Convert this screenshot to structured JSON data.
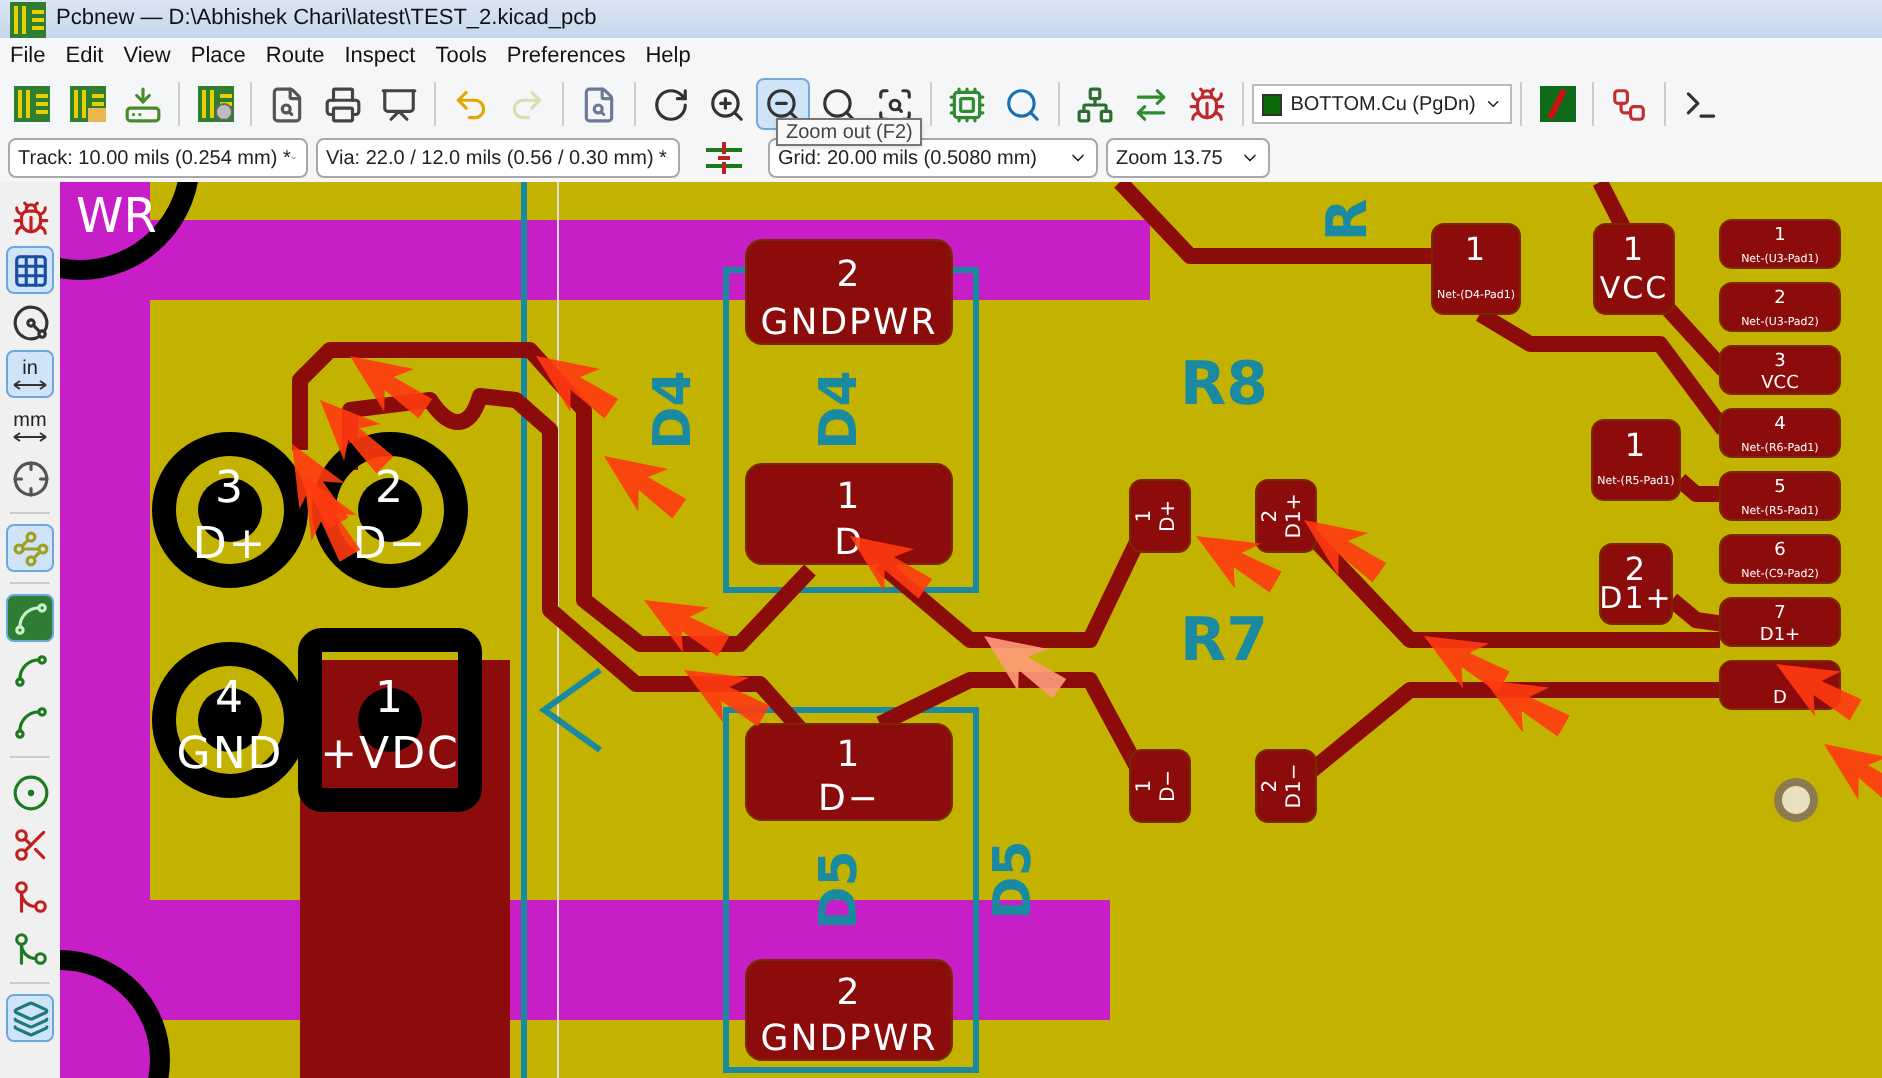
{
  "window": {
    "title": "Pcbnew — D:\\Abhishek Chari\\latest\\TEST_2.kicad_pcb"
  },
  "menu": [
    "File",
    "Edit",
    "View",
    "Place",
    "Route",
    "Inspect",
    "Tools",
    "Preferences",
    "Help"
  ],
  "toolbar": [
    {
      "highlighted": false
    },
    {
      "highlighted": false
    },
    {
      "highlighted": false
    },
    {
      "highlighted": false
    },
    {
      "highlighted": false
    },
    {
      "highlighted": false
    },
    {
      "highlighted": false
    },
    {
      "highlighted": false
    },
    {
      "highlighted": false
    },
    {
      "highlighted": false
    },
    {
      "highlighted": false
    },
    {
      "highlighted": false
    },
    {
      "highlighted": true
    },
    {
      "highlighted": false
    },
    {
      "highlighted": false
    },
    {
      "highlighted": false
    },
    {
      "highlighted": false
    },
    {
      "highlighted": false
    },
    {
      "highlighted": false
    },
    {
      "highlighted": false
    }
  ],
  "layer_select": {
    "value": "BOTTOM.Cu (PgDn)"
  },
  "toolbar_right": [
    {
      "highlighted": false
    },
    {
      "highlighted": false
    },
    {
      "highlighted": false
    }
  ],
  "tooltip": "Zoom out (F2)",
  "options_bar": {
    "track": "Track: 10.00 mils (0.254 mm) *",
    "via": "Via: 22.0 / 12.0 mils (0.56 / 0.30 mm) *",
    "grid": "Grid: 20.00 mils (0.5080 mm)",
    "zoom": "Zoom 13.75"
  },
  "left_toolbar": [
    {
      "on": false
    },
    {
      "on": true
    },
    {
      "on": false
    },
    {
      "on": true,
      "label": "in"
    },
    {
      "on": false,
      "label": "mm"
    },
    {
      "on": false
    },
    {
      "on": true
    },
    {
      "on": true
    },
    {
      "on": false
    },
    {
      "on": false
    },
    {
      "on": false
    },
    {
      "on": false
    },
    {
      "on": false
    },
    {
      "on": false
    },
    {
      "on": true
    }
  ],
  "canvas": {
    "texts": [
      "WR"
    ],
    "references": [
      "D4",
      "D4",
      "R8",
      "R7",
      "D5",
      "D5",
      "R"
    ],
    "pads": [
      {
        "kind": "smd",
        "number": "2",
        "net": "GNDPWR"
      },
      {
        "kind": "smd",
        "number": "1",
        "net": "D"
      },
      {
        "kind": "smd",
        "number": "1",
        "net": "D−"
      },
      {
        "kind": "smd",
        "number": "2",
        "net": "GNDPWR"
      },
      {
        "kind": "round",
        "number": "3",
        "net": "D+"
      },
      {
        "kind": "round",
        "number": "2",
        "net": "D−"
      },
      {
        "kind": "round",
        "number": "4",
        "net": "GND"
      },
      {
        "kind": "square",
        "number": "1",
        "net": "+VDC"
      },
      {
        "kind": "small",
        "number": "1",
        "net": "D+"
      },
      {
        "kind": "small",
        "number": "2",
        "net": "D1+"
      },
      {
        "kind": "small",
        "number": "1",
        "net": "D−"
      },
      {
        "kind": "small",
        "number": "2",
        "net": "D1−"
      },
      {
        "kind": "medium",
        "number": "1",
        "net": "Net-(D4-Pad1)"
      },
      {
        "kind": "medium",
        "number": "1",
        "net": "VCC"
      },
      {
        "kind": "medium",
        "number": "1",
        "net": "Net-(R5-Pad1)"
      },
      {
        "kind": "medium",
        "number": "2",
        "net": "D1+"
      },
      {
        "kind": "connector",
        "number": "1",
        "net": "Net-(U3-Pad1)"
      },
      {
        "kind": "connector",
        "number": "2",
        "net": "Net-(U3-Pad2)"
      },
      {
        "kind": "connector",
        "number": "3",
        "net": "VCC"
      },
      {
        "kind": "connector",
        "number": "4",
        "net": "Net-(R6-Pad1)"
      },
      {
        "kind": "connector",
        "number": "5",
        "net": "Net-(R5-Pad1)"
      },
      {
        "kind": "connector",
        "number": "6",
        "net": "Net-(C9-Pad2)"
      },
      {
        "kind": "connector",
        "number": "7",
        "net": "D1+"
      },
      {
        "kind": "connector",
        "net": "D"
      }
    ]
  }
}
